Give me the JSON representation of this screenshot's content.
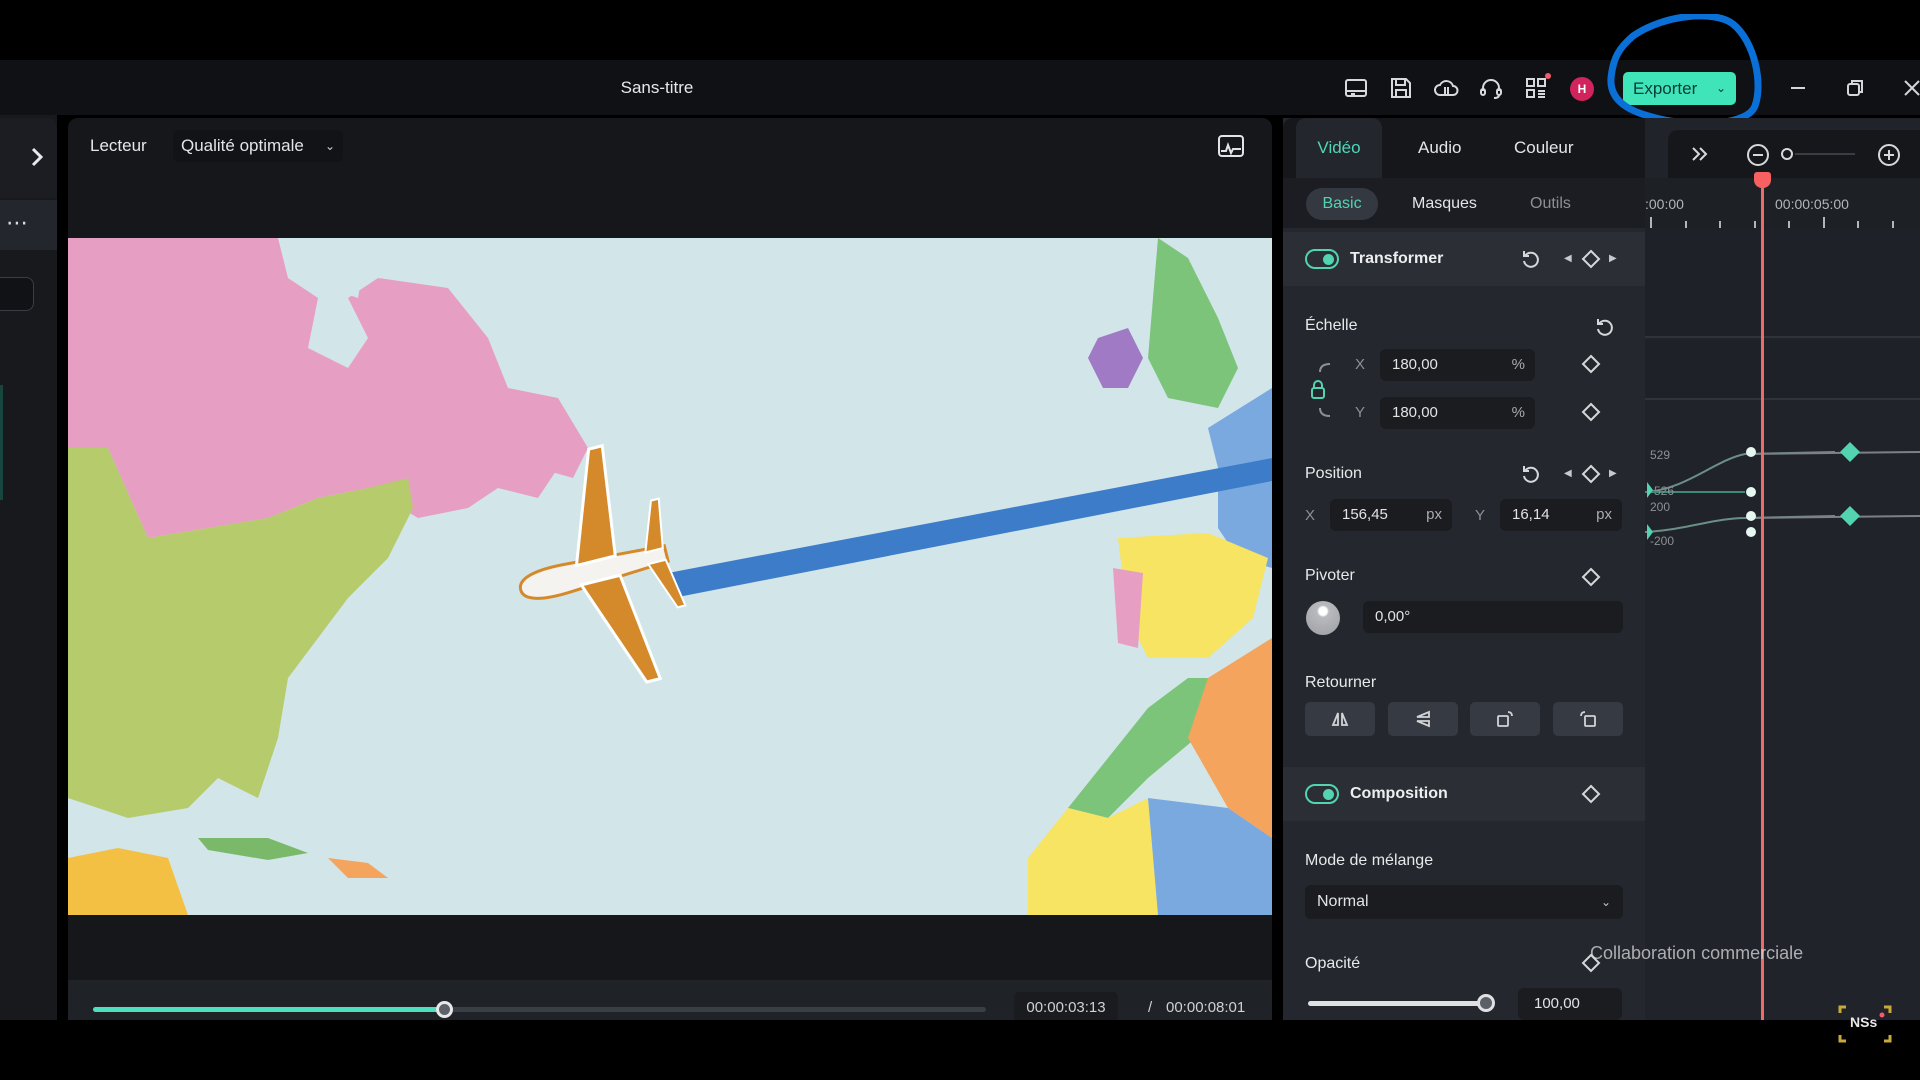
{
  "window": {
    "title": "Sans-titre",
    "toolbar_icons": [
      "layout-icon",
      "save-icon",
      "cloud-upload-icon",
      "headset-support-icon",
      "apps-grid-icon"
    ],
    "avatar_initial": "H",
    "export_label": "Exporter",
    "window_controls": [
      "minimize",
      "restore",
      "close"
    ]
  },
  "player": {
    "label": "Lecteur",
    "quality": "Qualité optimale",
    "current_time": "00:00:03:13",
    "separator": "/",
    "duration": "00:00:08:01",
    "progress_fraction": 0.395
  },
  "properties": {
    "tabs": [
      {
        "label": "Vidéo",
        "active": true
      },
      {
        "label": "Audio",
        "active": false
      },
      {
        "label": "Couleur",
        "active": false
      }
    ],
    "subtabs": [
      {
        "label": "Basic",
        "active": true
      },
      {
        "label": "Masques",
        "active": false
      },
      {
        "label": "Outils",
        "active": false
      }
    ],
    "transform": {
      "title": "Transformer",
      "enabled": true,
      "scale": {
        "label": "Échelle",
        "x": "180,00",
        "y": "180,00",
        "unit": "%",
        "locked": true
      },
      "position": {
        "label": "Position",
        "x": "156,45",
        "y": "16,14",
        "unit": "px"
      },
      "rotate": {
        "label": "Pivoter",
        "value": "0,00°"
      },
      "flip": {
        "label": "Retourner",
        "buttons": [
          "flip-horizontal",
          "flip-vertical",
          "rotate-clockwise",
          "rotate-counterclockwise"
        ]
      }
    },
    "composition": {
      "title": "Composition",
      "enabled": true,
      "blend_label": "Mode de mélange",
      "blend_value": "Normal",
      "opacity_label": "Opacité",
      "opacity_value": "100,00",
      "opacity_fraction": 1.0
    },
    "axis_x": "X",
    "axis_y": "Y"
  },
  "timeline": {
    "ruler_labels": [
      ":00:00",
      "00:00:05:00"
    ],
    "curve_labels": [
      "529",
      "526",
      "200",
      "-200"
    ],
    "accent": "#52d3b2",
    "playhead_color": "#f06a6a"
  },
  "overlay": {
    "watermark": "Collaboration commerciale",
    "badge": "NSs"
  },
  "colors": {
    "accent": "#52d3b2",
    "export_bg": "#3fe5b8",
    "annotation": "#0a6fd6"
  }
}
